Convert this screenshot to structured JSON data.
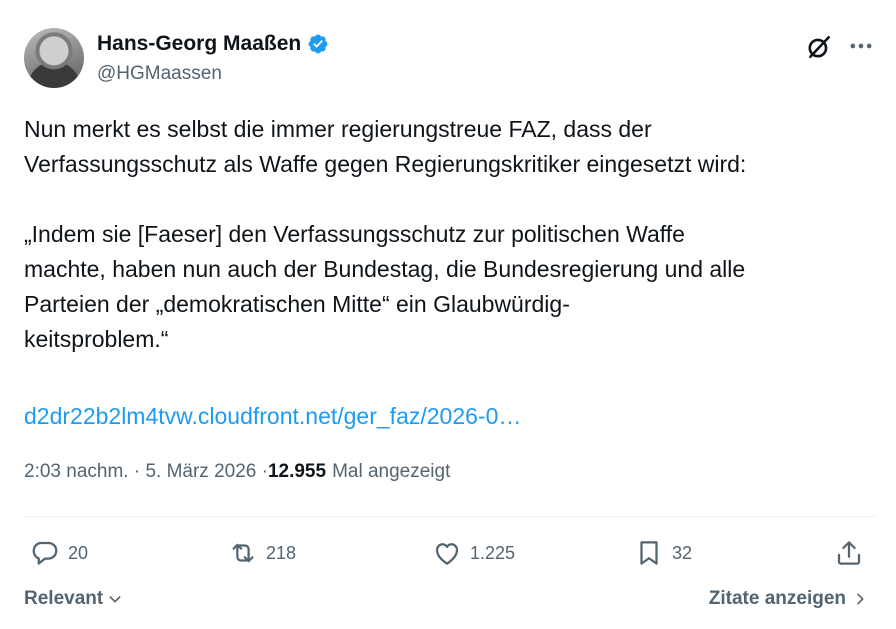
{
  "author": {
    "name": "Hans-Georg Maaßen",
    "handle": "@HGMaassen",
    "verified_color": "#1d9bf0"
  },
  "tweet": {
    "text": "Nun merkt es selbst die immer regierungstreue FAZ, dass der\nVerfassungsschutz als Waffe gegen Regierungskritiker eingesetzt wird:\n\n„Indem sie [Faeser] den Verfassungsschutz zur politischen Waffe\nmachte, haben nun auch der Bundestag, die Bundesregierung und alle\nParteien der „demokratischen Mitte“ ein Glaubwürdig-\nkeitsproblem.“",
    "link": "d2dr22b2lm4tvw.cloudfront.net/ger_faz/2026-0…",
    "time": "2:03 nachm. · 5. März 2026 · ",
    "views": "12.955",
    "views_label": "Mal angezeigt"
  },
  "actions": {
    "replies": "20",
    "reposts": "218",
    "likes": "1.225",
    "bookmarks": "32"
  },
  "footer": {
    "sort_label": "Relevant",
    "quotes_label": "Zitate anzeigen"
  },
  "icons": [
    "verified-badge-icon",
    "grok-icon",
    "more-icon",
    "reply-icon",
    "repost-icon",
    "like-icon",
    "bookmark-icon",
    "share-icon",
    "chevron-down-icon",
    "chevron-right-icon"
  ]
}
